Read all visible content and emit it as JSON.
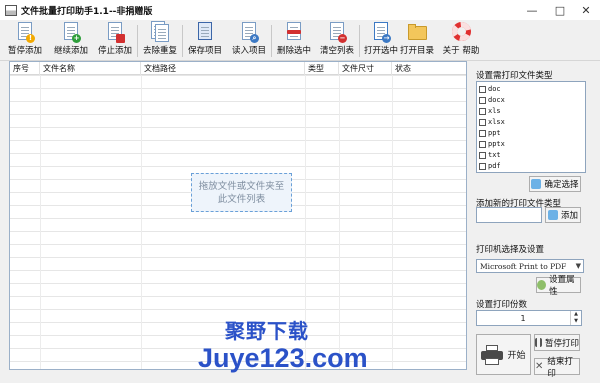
{
  "window": {
    "title": "文件批量打印助手1.1--非捐赠版",
    "controls": [
      "—",
      "□",
      "✕"
    ]
  },
  "toolbar": {
    "buttons": [
      {
        "label": "暂停添加",
        "icon": "pause-add-icon"
      },
      {
        "label": "继续添加",
        "icon": "resume-add-icon"
      },
      {
        "label": "停止添加",
        "icon": "stop-add-icon"
      },
      {
        "label": "去除重复",
        "icon": "remove-duplicates-icon"
      },
      {
        "label": "保存项目",
        "icon": "save-project-icon"
      },
      {
        "label": "读入项目",
        "icon": "load-project-icon"
      },
      {
        "label": "删除选中",
        "icon": "delete-selected-icon"
      },
      {
        "label": "清空列表",
        "icon": "clear-list-icon"
      },
      {
        "label": "打开选中",
        "icon": "open-selected-icon"
      },
      {
        "label": "打开目录",
        "icon": "open-folder-icon"
      },
      {
        "label": "关于 帮助",
        "icon": "help-lifebuoy-icon"
      }
    ]
  },
  "table": {
    "columns": [
      "序号",
      "文件名称",
      "文档路径",
      "类型",
      "文件尺寸",
      "状态"
    ],
    "rows": [],
    "dropzone_text": "拖放文件或文件夹至此文件列表"
  },
  "panel": {
    "file_types_title": "设置需打印文件类型",
    "file_types": [
      "doc",
      "docx",
      "xls",
      "xlsx",
      "ppt",
      "pptx",
      "txt",
      "pdf"
    ],
    "confirm_button": "确定选择",
    "add_type_title": "添加新的打印文件类型",
    "add_type_value": "",
    "add_button": "添加",
    "printer_title": "打印机选择及设置",
    "printer_selected": "Microsoft Print to PDF",
    "printer_props_button": "设置属性",
    "copies_title": "设置打印份数",
    "copies_value": "1",
    "start_button": "开始",
    "pause_print_button": "暂停打印",
    "end_print_button": "结束打印"
  },
  "watermark": {
    "line1": "聚野下载",
    "line2": "Juye123.com"
  }
}
